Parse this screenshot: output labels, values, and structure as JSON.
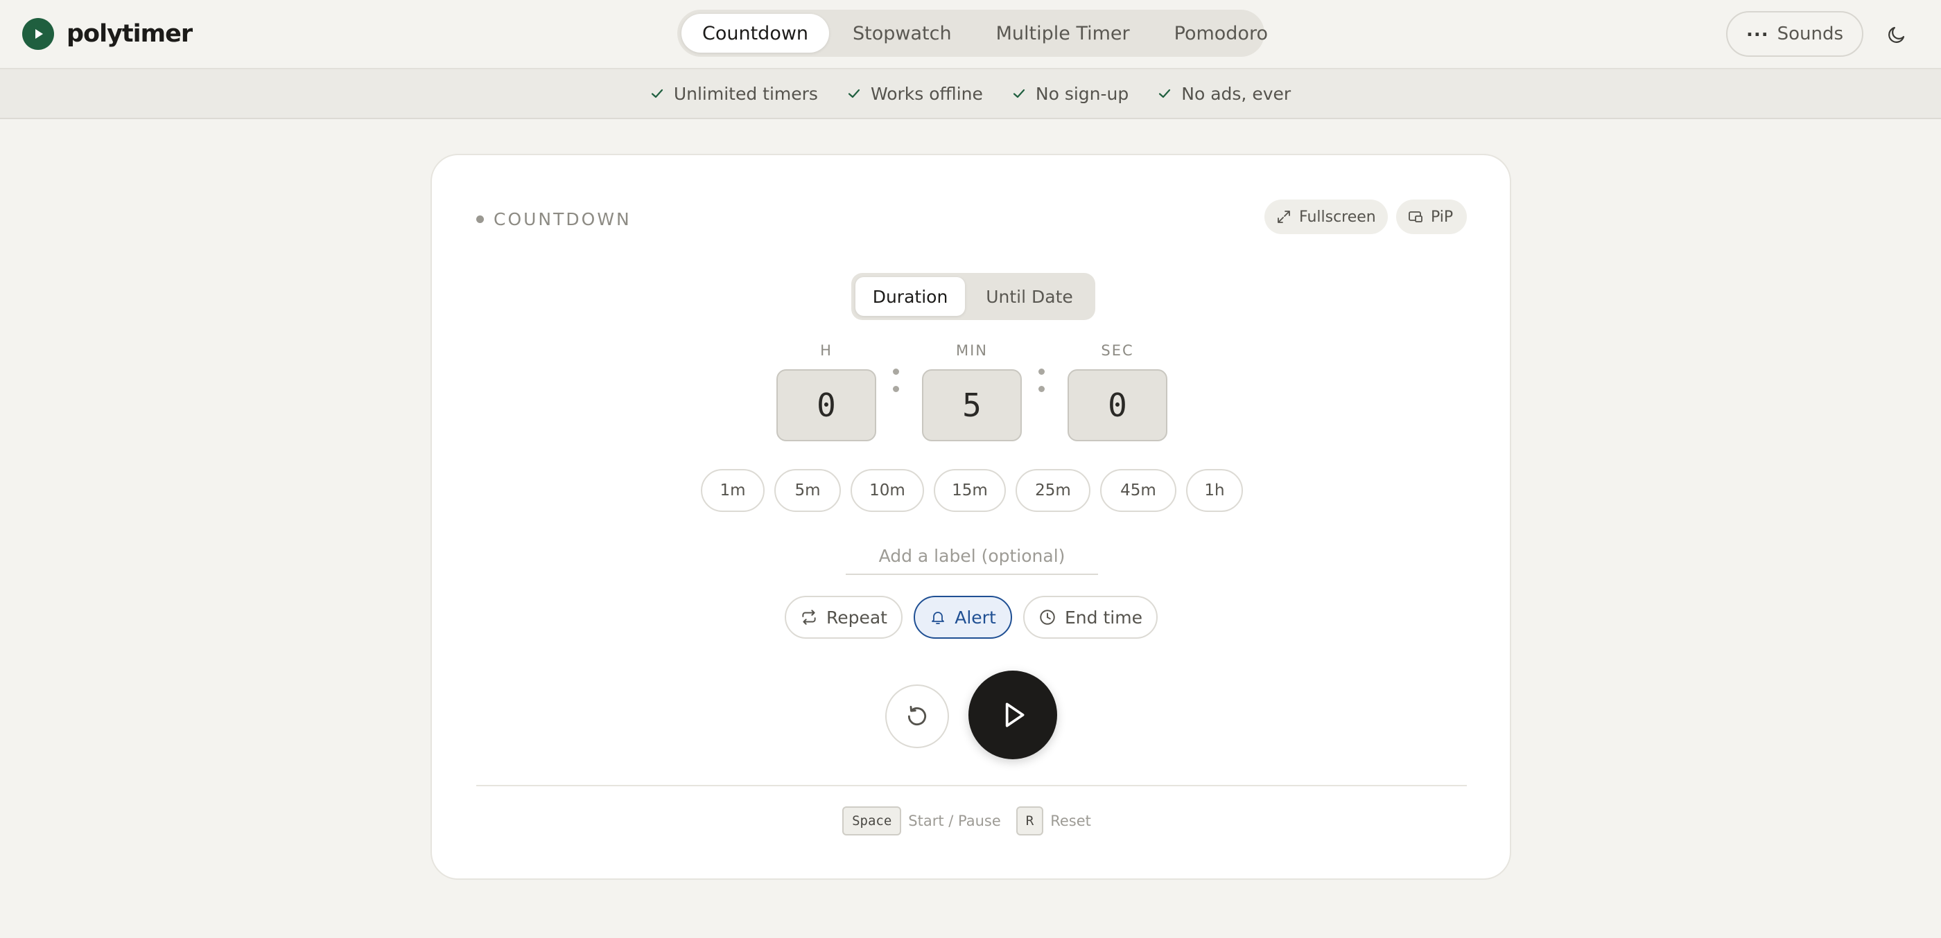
{
  "header": {
    "brand": "polytimer",
    "tabs": [
      {
        "label": "Countdown",
        "active": true
      },
      {
        "label": "Stopwatch"
      },
      {
        "label": "Multiple Timer"
      },
      {
        "label": "Pomodoro"
      }
    ],
    "sounds_label": "Sounds",
    "sounds_dots": "..."
  },
  "features": [
    "Unlimited timers",
    "Works offline",
    "No sign-up",
    "No ads, ever"
  ],
  "card": {
    "title": "COUNTDOWN",
    "fullscreen_label": "Fullscreen",
    "pip_label": "PiP",
    "mode": {
      "options": [
        "Duration",
        "Until Date"
      ],
      "active": "Duration"
    },
    "time": {
      "hours_label": "H",
      "hours": "0",
      "minutes_label": "MIN",
      "minutes": "5",
      "seconds_label": "SEC",
      "seconds": "0"
    },
    "presets": [
      "1m",
      "5m",
      "10m",
      "15m",
      "25m",
      "45m",
      "1h"
    ],
    "label_placeholder": "Add a label (optional)",
    "options": {
      "repeat": "Repeat",
      "alert": "Alert",
      "end_time": "End time"
    },
    "alert_on": true,
    "shortcuts": {
      "start_key": "Space",
      "start_text": "Start / Pause",
      "reset_key": "R",
      "reset_text": "Reset"
    }
  },
  "colors": {
    "brand_green": "#1f5f3f",
    "accent_blue": "#1f4f93",
    "play_button": "#1c1b19",
    "background": "#f4f3ef"
  },
  "icons": [
    "play-logo-icon",
    "moon-icon",
    "check-icon",
    "expand-icon",
    "pip-icon",
    "repeat-icon",
    "bell-icon",
    "clock-icon",
    "reset-icon",
    "play-icon"
  ]
}
